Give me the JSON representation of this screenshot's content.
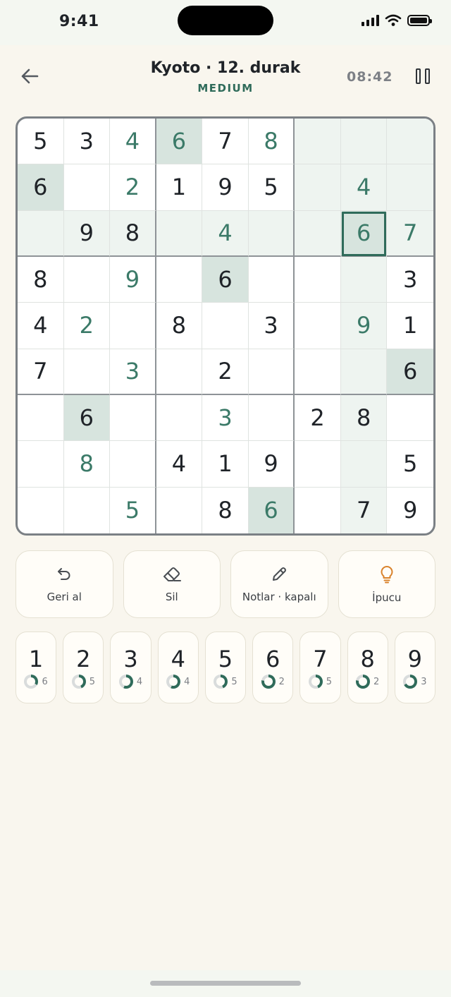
{
  "status": {
    "time": "9:41"
  },
  "header": {
    "title": "Kyoto · 12. durak",
    "difficulty": "MEDIUM",
    "timer": "08:42"
  },
  "board": {
    "rows": [
      [
        "5",
        "3",
        "4",
        "6",
        "7",
        "8",
        "",
        "",
        ""
      ],
      [
        "6",
        "",
        "2",
        "1",
        "9",
        "5",
        "",
        "4",
        ""
      ],
      [
        "",
        "9",
        "8",
        "",
        "4",
        "",
        "",
        "6",
        "7"
      ],
      [
        "8",
        "",
        "9",
        "",
        "6",
        "",
        "",
        "",
        "3"
      ],
      [
        "4",
        "2",
        "",
        "8",
        "",
        "3",
        "",
        "9",
        "1"
      ],
      [
        "7",
        "",
        "3",
        "",
        "2",
        "",
        "",
        "",
        "6"
      ],
      [
        "",
        "6",
        "",
        "",
        "3",
        "",
        "2",
        "8",
        ""
      ],
      [
        "",
        "8",
        "",
        "4",
        "1",
        "9",
        "",
        "",
        "5"
      ],
      [
        "",
        "",
        "5",
        "",
        "8",
        "6",
        "",
        "7",
        "9"
      ]
    ],
    "user_entries": [
      [
        0,
        2
      ],
      [
        0,
        3
      ],
      [
        0,
        5
      ],
      [
        1,
        2
      ],
      [
        1,
        7
      ],
      [
        2,
        4
      ],
      [
        2,
        7
      ],
      [
        2,
        8
      ],
      [
        3,
        2
      ],
      [
        4,
        1
      ],
      [
        4,
        7
      ],
      [
        5,
        2
      ],
      [
        6,
        4
      ],
      [
        7,
        1
      ],
      [
        8,
        2
      ],
      [
        8,
        5
      ]
    ],
    "selected": [
      2,
      7
    ],
    "selected_value": "6"
  },
  "actions": [
    {
      "id": "undo",
      "label": "Geri al",
      "icon": "undo-icon"
    },
    {
      "id": "erase",
      "label": "Sil",
      "icon": "eraser-icon"
    },
    {
      "id": "notes",
      "label": "Notlar · kapalı",
      "icon": "pencil-icon"
    },
    {
      "id": "hint",
      "label": "İpucu",
      "icon": "lightbulb-icon"
    }
  ],
  "numpad": [
    {
      "digit": "1",
      "remaining": "6",
      "progress": 0.33
    },
    {
      "digit": "2",
      "remaining": "5",
      "progress": 0.44
    },
    {
      "digit": "3",
      "remaining": "4",
      "progress": 0.56
    },
    {
      "digit": "4",
      "remaining": "4",
      "progress": 0.56
    },
    {
      "digit": "5",
      "remaining": "5",
      "progress": 0.44
    },
    {
      "digit": "6",
      "remaining": "2",
      "progress": 0.78
    },
    {
      "digit": "7",
      "remaining": "5",
      "progress": 0.44
    },
    {
      "digit": "8",
      "remaining": "2",
      "progress": 0.78
    },
    {
      "digit": "9",
      "remaining": "3",
      "progress": 0.67
    }
  ],
  "colors": {
    "accent": "#2f6b5a",
    "user_digit": "#3b7a68",
    "hint": "#d9822b",
    "highlight": "#eef4f0",
    "same_value": "#d7e4de",
    "ring_track": "#d9dcdc"
  }
}
